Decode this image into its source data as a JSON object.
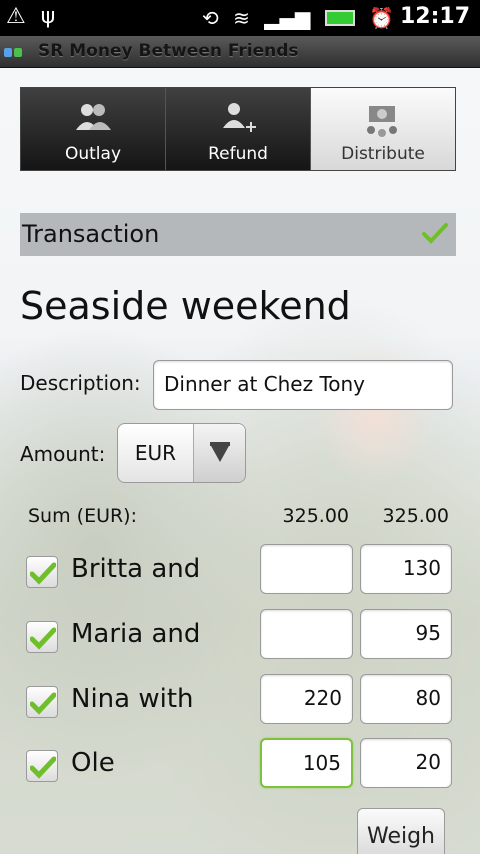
{
  "status_bar": {
    "time": "12:17",
    "left_icons": [
      "warning-triangle-icon",
      "usb-icon"
    ],
    "right_icons": [
      "rotate-icon",
      "wifi-icon",
      "signal-icon",
      "battery-icon",
      "alarm-icon"
    ]
  },
  "app": {
    "title": "SR Money Between Friends"
  },
  "tabs": [
    {
      "label": "Outlay",
      "icon": "people-icon",
      "active": false
    },
    {
      "label": "Refund",
      "icon": "person-add-icon",
      "active": false
    },
    {
      "label": "Distribute",
      "icon": "coins-distribute-icon",
      "active": true
    }
  ],
  "section": {
    "label": "Transaction"
  },
  "page_title": "Seaside weekend",
  "description": {
    "label": "Description:",
    "value": "Dinner at Chez Tony"
  },
  "amount": {
    "label": "Amount:",
    "currency": "EUR"
  },
  "sum": {
    "label": "Sum (EUR):",
    "col1": "325.00",
    "col2": "325.00"
  },
  "people": [
    {
      "name": "Britta and",
      "checked": true,
      "value1": "",
      "value2": "130"
    },
    {
      "name": "Maria and",
      "checked": true,
      "value1": "",
      "value2": "95"
    },
    {
      "name": "Nina with",
      "checked": true,
      "value1": "220",
      "value2": "80"
    },
    {
      "name": "Ole",
      "checked": true,
      "value1": "105",
      "value2": "20"
    }
  ],
  "weigh_button": "Weigh",
  "colors": {
    "check_green": "#6fbf2a",
    "focus_green": "#7ec142",
    "titlebar": "#3a3a3a"
  }
}
